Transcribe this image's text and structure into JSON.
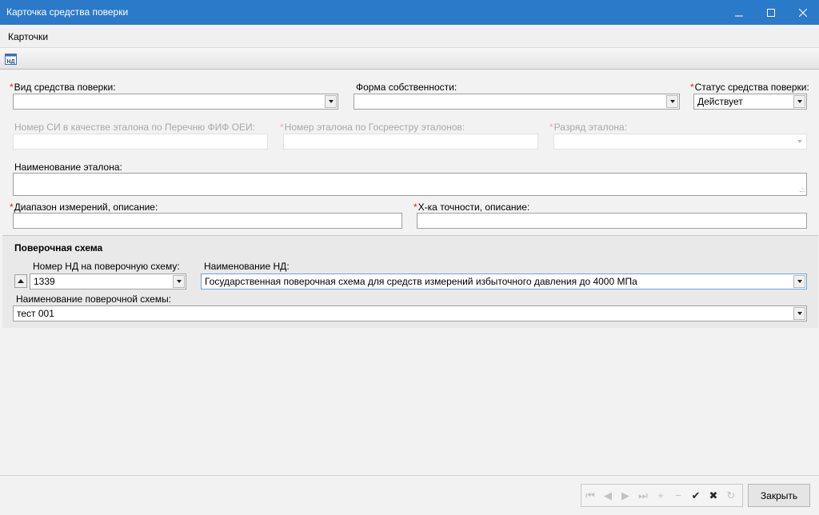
{
  "window": {
    "title": "Карточка средства поверки"
  },
  "menu": {
    "items": [
      "Карточки"
    ]
  },
  "toolbar": {
    "nd_icon_label": "НД"
  },
  "form": {
    "vid": {
      "label": "Вид средства поверки:",
      "required": true,
      "value": ""
    },
    "forma": {
      "label": "Форма собственности:",
      "required": false,
      "value": ""
    },
    "status": {
      "label": "Статус средства поверки:",
      "required": true,
      "value": "Действует"
    },
    "nomer_si": {
      "label": "Номер СИ в качестве эталона по Перечню ФИФ ОЕИ:",
      "disabled": true,
      "value": ""
    },
    "nomer_etalona": {
      "label": "Номер эталона по Госреестру эталонов:",
      "required": true,
      "disabled": true,
      "value": ""
    },
    "razryad": {
      "label": "Разряд эталона:",
      "required": true,
      "disabled": true,
      "value": ""
    },
    "naim_etalona": {
      "label": "Наименование эталона:",
      "value": ""
    },
    "diapazon": {
      "label": "Диапазон измерений, описание:",
      "required": true,
      "value": ""
    },
    "tochnost": {
      "label": "Х-ка точности, описание:",
      "required": true,
      "value": ""
    }
  },
  "schema": {
    "title": "Поверочная схема",
    "nomer_nd": {
      "label": "Номер НД на поверочную схему:",
      "value": "1339"
    },
    "naim_nd": {
      "label": "Наименование НД:",
      "value": "Государственная поверочная схема для средств измерений избыточного давления до 4000 МПа"
    },
    "naim_schemy": {
      "label": "Наименование поверочной схемы:",
      "value": "тест 001"
    }
  },
  "footer": {
    "nav": {
      "first": "⏮",
      "prev": "◀",
      "next": "▶",
      "last": "⏭",
      "add": "+",
      "remove": "−",
      "apply": "✔",
      "cancel": "✖",
      "refresh": "↻"
    },
    "close_label": "Закрыть"
  },
  "colors": {
    "titlebar": "#2b79c9",
    "required_mark": "#e0201c",
    "focus_border": "#6aa5e0"
  }
}
